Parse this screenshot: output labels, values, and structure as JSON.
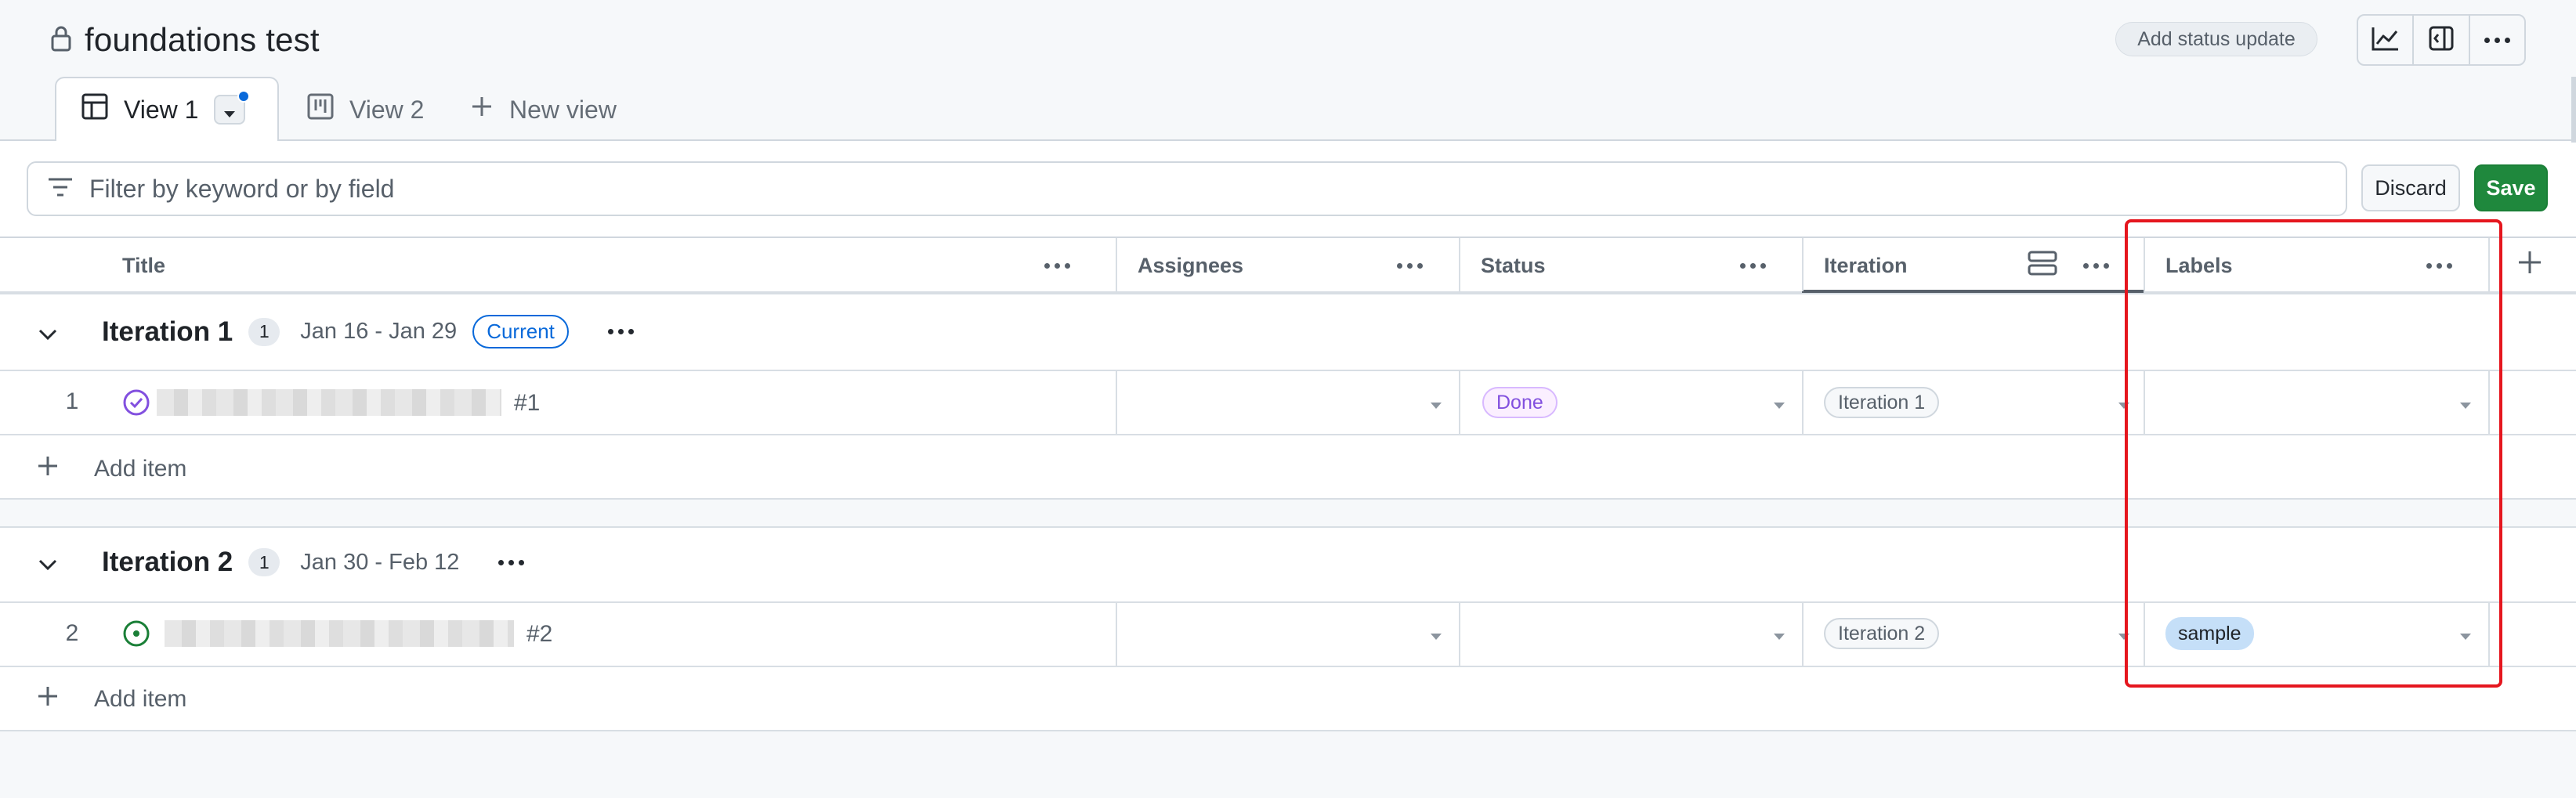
{
  "project": {
    "title": "foundations test",
    "status_update_label": "Add status update"
  },
  "tabs": [
    {
      "label": "View 1",
      "active": true
    },
    {
      "label": "View 2",
      "active": false
    },
    {
      "label": "New view",
      "active": false
    }
  ],
  "filter": {
    "placeholder": "Filter by keyword or by field",
    "discard_label": "Discard",
    "save_label": "Save"
  },
  "columns": [
    "Title",
    "Assignees",
    "Status",
    "Iteration",
    "Labels"
  ],
  "groups": [
    {
      "name": "Iteration 1",
      "count": "1",
      "dates": "Jan 16 - Jan 29",
      "badge": "Current",
      "rows": [
        {
          "index": "1",
          "number": "#1",
          "status": "Done",
          "iteration": "Iteration 1",
          "label": "",
          "state": "done"
        }
      ],
      "add_item_label": "Add item"
    },
    {
      "name": "Iteration 2",
      "count": "1",
      "dates": "Jan 30 - Feb 12",
      "rows": [
        {
          "index": "2",
          "number": "#2",
          "status": "",
          "iteration": "Iteration 2",
          "label": "sample",
          "state": "open"
        }
      ],
      "add_item_label": "Add item"
    }
  ],
  "colors": {
    "accent_blue": "#0969da",
    "save_green": "#1f883d",
    "done_purple": "#8250df",
    "open_green": "#1a7f37",
    "highlight_red": "#e5161e",
    "label_blue": "#c5dff8"
  }
}
